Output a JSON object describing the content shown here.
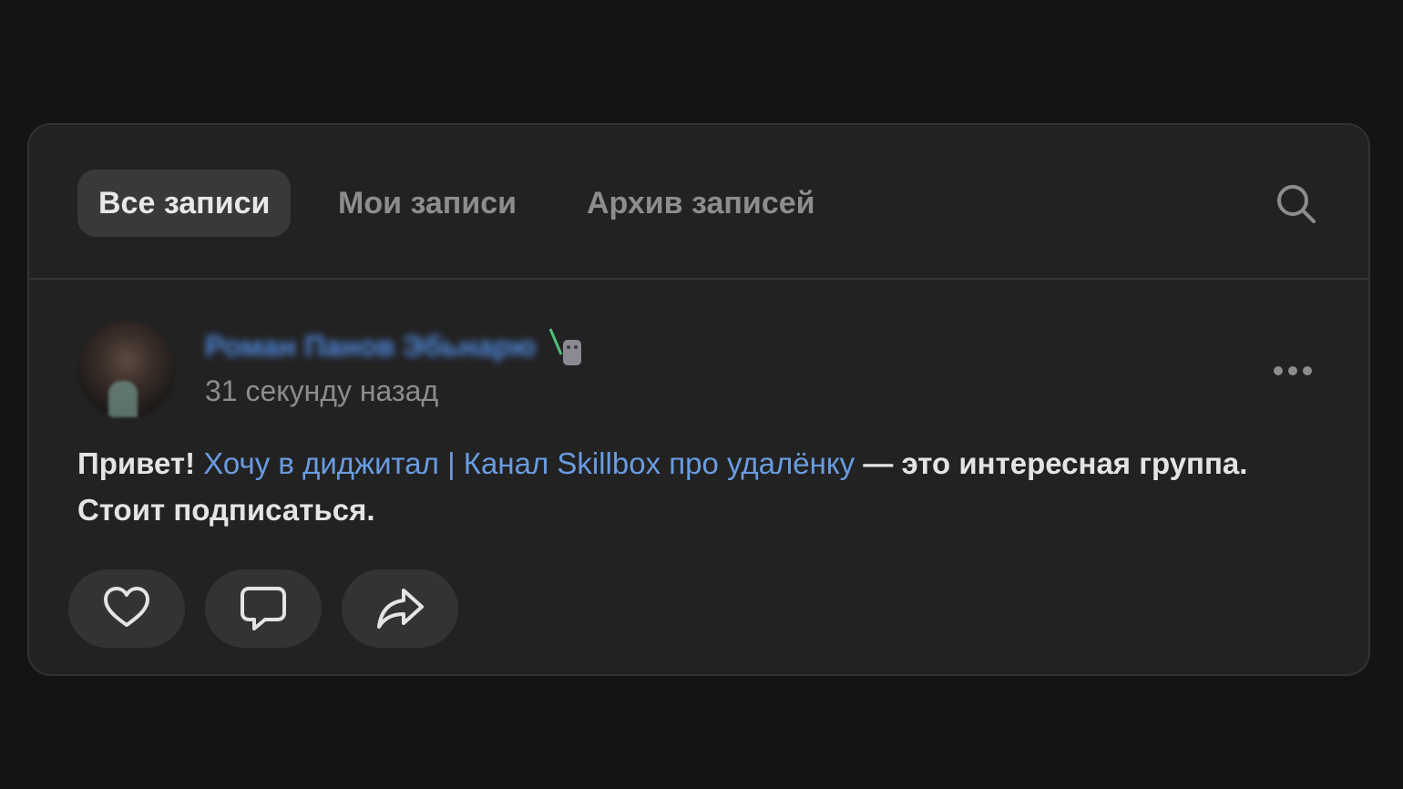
{
  "tabs": {
    "all": "Все записи",
    "mine": "Мои записи",
    "archive": "Архив записей"
  },
  "icons": {
    "search": "search-icon",
    "more": "more-horizontal-icon",
    "like": "heart-icon",
    "comment": "comment-icon",
    "share": "share-icon"
  },
  "post": {
    "author_name": "Роман Панов Эбьнарю",
    "timestamp": "31 секунду назад",
    "text_before": "Привет! ",
    "link_text": "Хочу в диджитал | Канал Skillbox про удалёнку",
    "text_after": " — это интересная группа. Стоит подписаться."
  },
  "colors": {
    "background": "#141414",
    "card": "#222223",
    "active_tab": "#39393a",
    "link": "#6a9ce0",
    "author_link": "#4f86d8",
    "muted_text": "#8c8d8f"
  }
}
